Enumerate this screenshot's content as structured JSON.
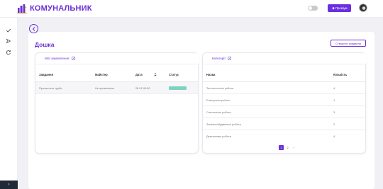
{
  "app": {
    "name": "КОМУНАЛЬНИК",
    "accent": "#6a2fd8"
  },
  "header": {
    "premium_label": "Преміум"
  },
  "sidebar": {
    "icons": [
      "check-icon",
      "send-icon",
      "refresh-icon"
    ],
    "expand_label": "›"
  },
  "page": {
    "title": "Дошка",
    "create_button": "Створити завдання"
  },
  "orders": {
    "tab_label": "Мої замовлення",
    "columns": [
      "Завдання",
      "Майстер",
      "Дата",
      "Статус"
    ],
    "rows": [
      {
        "task": "Прочистити труби",
        "master": "Не призначено",
        "date": "26.01.05:50",
        "status": ""
      }
    ]
  },
  "categories": {
    "tab_label": "Категорії",
    "columns": [
      "Назва",
      "Кількість"
    ],
    "rows": [
      {
        "name": "Теплотехнічні роботи",
        "count": "4"
      },
      {
        "name": "Електричні роботи",
        "count": "1"
      },
      {
        "name": "Сантехнічні роботи",
        "count": "3"
      },
      {
        "name": "Загальнобудівельні роботи",
        "count": "2"
      },
      {
        "name": "Демонтажні роботи",
        "count": "4"
      }
    ]
  },
  "pagination": {
    "pages": [
      "1",
      "2"
    ],
    "active": "1",
    "next": "›"
  }
}
